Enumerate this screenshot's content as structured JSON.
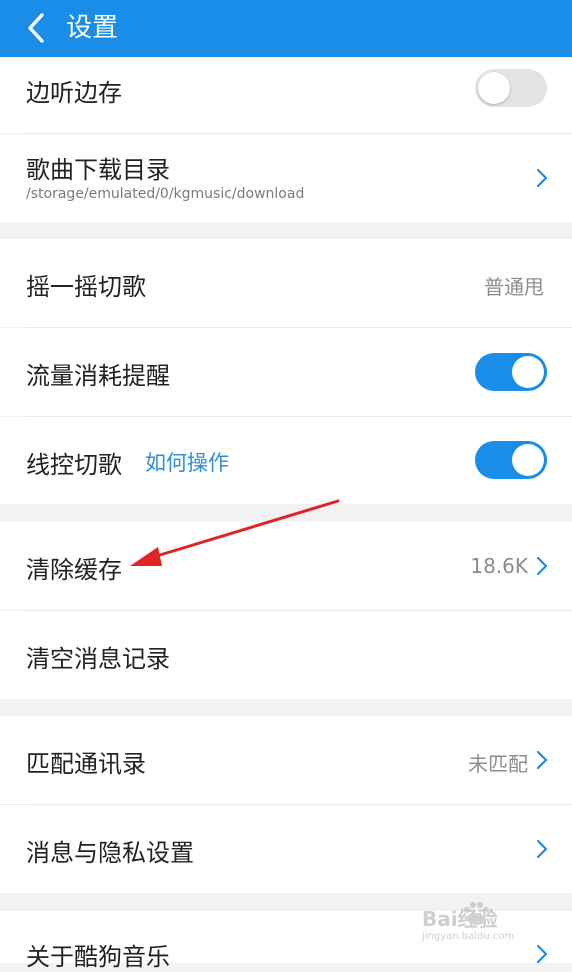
{
  "header": {
    "title": "设置"
  },
  "settings": {
    "listen_cache": {
      "label": "边听边存",
      "toggle_on": false
    },
    "download_dir": {
      "label": "歌曲下载目录",
      "path": "/storage/emulated/0/kgmusic/download"
    },
    "shake": {
      "label": "摇一摇切歌",
      "value": "普通甩"
    },
    "traffic": {
      "label": "流量消耗提醒",
      "toggle_on": true
    },
    "wire": {
      "label": "线控切歌",
      "link": "如何操作",
      "toggle_on": true
    },
    "clear_cache": {
      "label": "清除缓存",
      "value": "18.6K"
    },
    "clear_msg": {
      "label": "清空消息记录"
    },
    "contacts": {
      "label": "匹配通讯录",
      "value": "未匹配"
    },
    "privacy": {
      "label": "消息与隐私设置"
    },
    "about": {
      "label": "关于酷狗音乐"
    }
  },
  "watermark": {
    "text": "Bai经验",
    "url": "jingyan.baidu.com"
  },
  "colors": {
    "accent": "#1a8de9",
    "annotation_arrow": "#e02424"
  }
}
